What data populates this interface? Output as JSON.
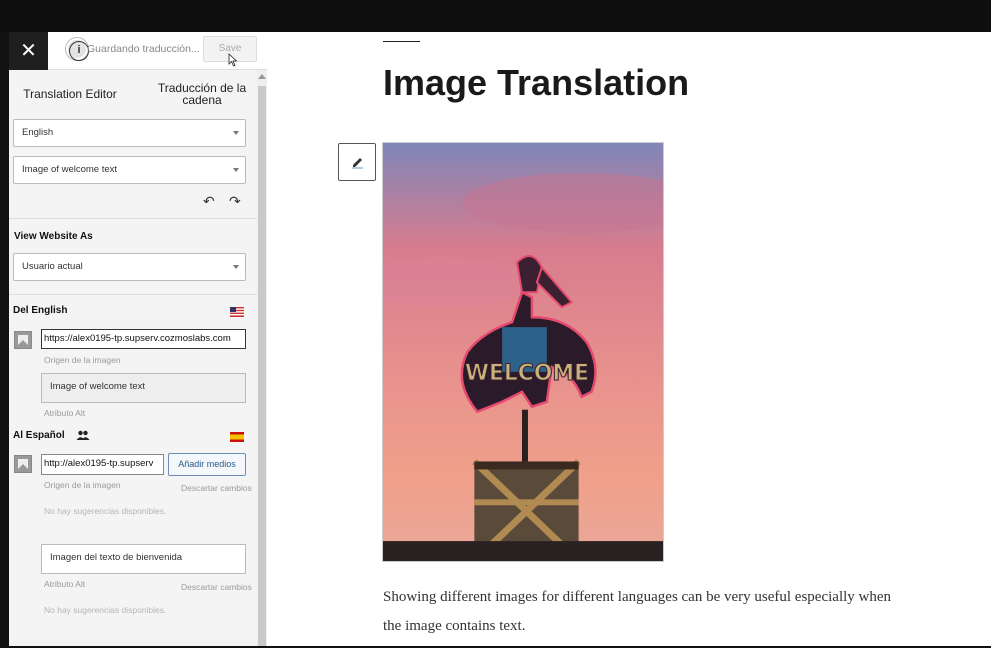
{
  "header": {
    "saving_status": "Guardando traducción...",
    "save_label": "Save"
  },
  "tabs": {
    "translation_editor": "Translation Editor",
    "string_translation": "Traducción de la cadena"
  },
  "language_select": {
    "value": "English"
  },
  "string_select": {
    "value": "Image of welcome text"
  },
  "view_as": {
    "heading": "View Website As",
    "value": "Usuario actual"
  },
  "source": {
    "heading": "Del English",
    "image_url": "https://alex0195-tp.supserv.cozmoslabs.com",
    "image_src_label": "Origen de la imagen",
    "alt_value": "Image of welcome text",
    "alt_label": "Atributo Alt"
  },
  "target": {
    "heading": "Al Español",
    "image_url": "http://alex0195-tp.supserv",
    "add_media_label": "Añadir medios",
    "image_src_label": "Origen de la imagen",
    "discard_1": "Descartar cambios",
    "no_suggestions_1": "No hay sugerencias disponibles.",
    "alt_value": "Imagen del texto de bienvenida",
    "alt_label": "Atributo Alt",
    "discard_2": "Descartar cambios",
    "no_suggestions_2": "No hay sugerencias disponibles."
  },
  "page": {
    "title": "Image Translation",
    "paragraph": "Showing different images for different languages can be very useful especially when the image contains text.",
    "sign_text": "WELCOME"
  },
  "icons": [
    "close-icon",
    "info-icon",
    "undo-icon",
    "redo-icon",
    "us-flag-icon",
    "image-icon",
    "users-icon",
    "spain-flag-icon",
    "pencil-icon"
  ]
}
